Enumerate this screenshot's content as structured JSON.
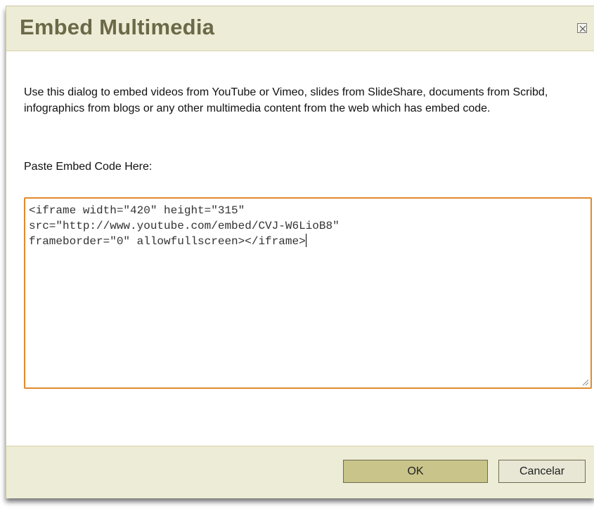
{
  "dialog": {
    "title": "Embed Multimedia",
    "close_icon": "close-x-icon",
    "description": "Use this dialog to embed videos from YouTube or Vimeo, slides from SlideShare, documents from Scribd, infographics from blogs or any other multimedia content from the web which has embed code.",
    "paste_label": "Paste Embed Code Here:",
    "embed_code": "<iframe width=\"420\" height=\"315\"\nsrc=\"http://www.youtube.com/embed/CVJ-W6LioB8\"\nframeborder=\"0\" allowfullscreen></iframe>",
    "ok_label": "OK",
    "cancel_label": "Cancelar"
  },
  "colors": {
    "title_text": "#6b6947",
    "header_bg": "#edecd6",
    "focus_border": "#e08a2c",
    "ok_button_bg": "#c9c489",
    "cancel_button_bg": "#e8e7d5"
  }
}
